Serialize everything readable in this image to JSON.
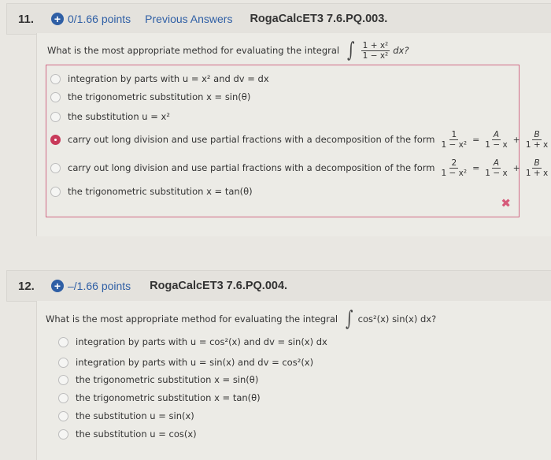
{
  "questions": [
    {
      "number": "11.",
      "points": "0/1.66 points",
      "previous_answers": "Previous Answers",
      "code": "RogaCalcET3 7.6.PQ.003.",
      "prompt": "What is the most appropriate method for evaluating the integral",
      "integrand": {
        "num": "1 + x²",
        "den": "1 − x²",
        "suffix": "dx?"
      },
      "options": [
        {
          "text": "integration by parts with u = x² and dv = dx",
          "selected": false
        },
        {
          "text": "the trigonometric substitution x = sin(θ)",
          "selected": false
        },
        {
          "text": "the substitution u = x²",
          "selected": false
        },
        {
          "text": "carry out long division and use partial fractions with a decomposition of the form",
          "selected": true,
          "formula": {
            "lhs_num": "1",
            "lhs_den": "1 − x²",
            "a_num": "A",
            "a_den": "1 − x",
            "b_num": "B",
            "b_den": "1 + x"
          }
        },
        {
          "text": "carry out long division and use partial fractions with a decomposition of the form",
          "selected": false,
          "formula": {
            "lhs_num": "2",
            "lhs_den": "1 − x²",
            "a_num": "A",
            "a_den": "1 − x",
            "b_num": "B",
            "b_den": "1 + x"
          }
        },
        {
          "text": "the trigonometric substitution x = tan(θ)",
          "selected": false
        }
      ],
      "result_icon": "✖",
      "accent_color": "#c83a5a"
    },
    {
      "number": "12.",
      "points": "–/1.66 points",
      "code": "RogaCalcET3 7.6.PQ.004.",
      "prompt": "What is the most appropriate method for evaluating the integral",
      "integrand_text": "cos²(x) sin(x) dx?",
      "options": [
        {
          "text": "integration by parts with u = cos²(x) and dv = sin(x) dx",
          "selected": false
        },
        {
          "text": "integration by parts with u = sin(x) and dv = cos²(x)",
          "selected": false
        },
        {
          "text": "the trigonometric substitution x = sin(θ)",
          "selected": false
        },
        {
          "text": "the trigonometric substitution x = tan(θ)",
          "selected": false
        },
        {
          "text": "the substitution u = sin(x)",
          "selected": false
        },
        {
          "text": "the substitution u = cos(x)",
          "selected": false
        }
      ]
    }
  ],
  "icons": {
    "plus": "+",
    "integral": "∫",
    "eq": "=",
    "plus_sign": "+"
  },
  "colors": {
    "link": "#2f5fa5",
    "wrong": "#d65a7a"
  }
}
